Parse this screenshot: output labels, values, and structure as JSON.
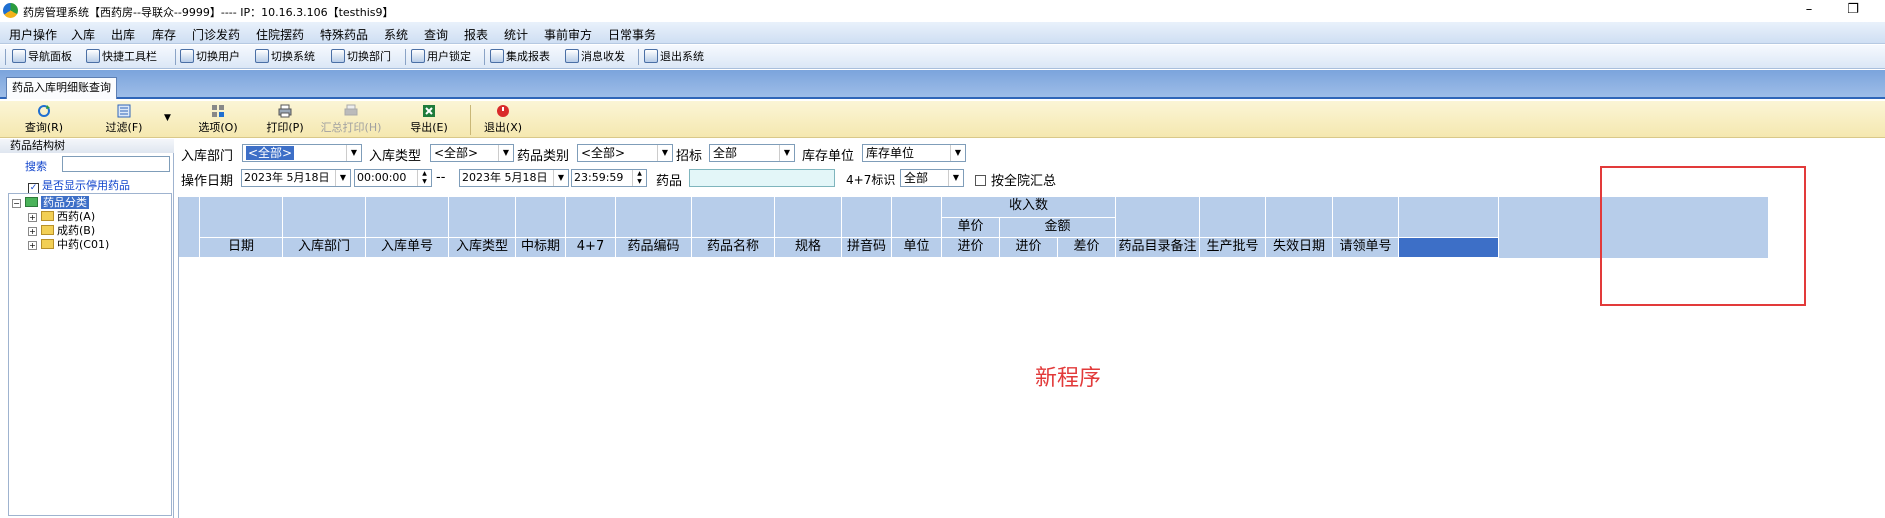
{
  "window": {
    "title": "药房管理系统【西药房--导联众--9999】---- IP：10.16.3.106【testhis9】",
    "minimize": "–",
    "restore": "❐"
  },
  "menu": [
    "用户操作",
    "入库",
    "出库",
    "库存",
    "门诊发药",
    "住院摆药",
    "特殊药品",
    "系统",
    "查询",
    "报表",
    "统计",
    "事前审方",
    "日常事务"
  ],
  "toolbar": [
    "导航面板",
    "快捷工具栏",
    "切换用户",
    "切换系统",
    "切换部门",
    "用户锁定",
    "集成报表",
    "消息收发",
    "退出系统"
  ],
  "tab": "药品入库明细账查询",
  "actions": {
    "query": "查询(R)",
    "filter": "过滤(F)",
    "filter_dropdown": "▼",
    "options": "选项(O)",
    "print": "打印(P)",
    "summary_print": "汇总打印(H)",
    "export": "导出(E)",
    "exit": "退出(X)"
  },
  "left": {
    "header": "药品结构树",
    "search_label": "搜索",
    "show_disabled": "是否显示停用药品",
    "tree": {
      "root": "药品分类",
      "children": [
        "西药(A)",
        "成药(B)",
        "中药(C01)"
      ]
    }
  },
  "filters": {
    "dept_label": "入库部门",
    "dept_value": "<全部>",
    "type_label": "入库类型",
    "type_value": "<全部>",
    "category_label": "药品类别",
    "category_value": "<全部>",
    "bid_label": "招标",
    "bid_value": "全部",
    "unit_label": "库存单位",
    "unit_value": "库存单位",
    "date_label": "操作日期",
    "date_from": "2023年 5月18日",
    "time_from": "00:00:00",
    "dash": "--",
    "date_to": "2023年 5月18日",
    "time_to": "23:59:59",
    "drug_label": "药品",
    "drug_value": "",
    "flag47_label": "4+7标识",
    "flag47_value": "全部",
    "hospital_summary": "按全院汇总"
  },
  "grid": {
    "group_header": "收入数",
    "sub_unit_price": "单价",
    "sub_amount": "金额",
    "columns": [
      "日期",
      "入库部门",
      "入库单号",
      "入库类型",
      "中标期",
      "4+7",
      "药品编码",
      "药品名称",
      "规格",
      "拼音码",
      "单位",
      "进价",
      "进价",
      "差价",
      "药品目录备注",
      "生产批号",
      "失效日期",
      "请领单号"
    ]
  },
  "overlay_text": "新程序",
  "colors": {
    "accent": "#3d6fc7",
    "header_bg": "#b7cdea",
    "annotation": "#e23a3a"
  }
}
